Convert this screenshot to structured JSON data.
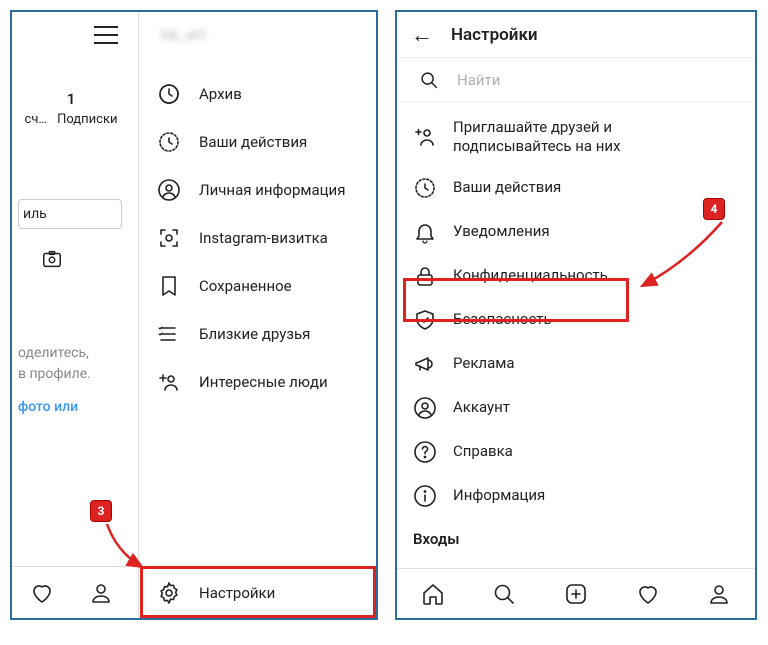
{
  "left": {
    "username": "bk_art",
    "stats": {
      "count": "1",
      "cut_left": "сч…",
      "label": "Подписки"
    },
    "profile_btn_cut": "иль",
    "share_line1": "оделитесь,",
    "share_line2": "в профиле.",
    "share_link": "фото или",
    "drawer": [
      {
        "label": "Архив"
      },
      {
        "label": "Ваши действия"
      },
      {
        "label": "Личная информация"
      },
      {
        "label": "Instagram-визитка"
      },
      {
        "label": "Сохраненное"
      },
      {
        "label": "Близкие друзья"
      },
      {
        "label": "Интересные люди"
      }
    ],
    "settings_label": "Настройки"
  },
  "right": {
    "title": "Настройки",
    "search_placeholder": "Найти",
    "items": [
      {
        "label": "Приглашайте друзей и подписывайтесь на них"
      },
      {
        "label": "Ваши действия"
      },
      {
        "label": "Уведомления"
      },
      {
        "label": "Конфиденциальность"
      },
      {
        "label": "Безопасность"
      },
      {
        "label": "Реклама"
      },
      {
        "label": "Аккаунт"
      },
      {
        "label": "Справка"
      },
      {
        "label": "Информация"
      }
    ],
    "section_logins": "Входы"
  },
  "annotations": {
    "badge3": "3",
    "badge4": "4"
  }
}
